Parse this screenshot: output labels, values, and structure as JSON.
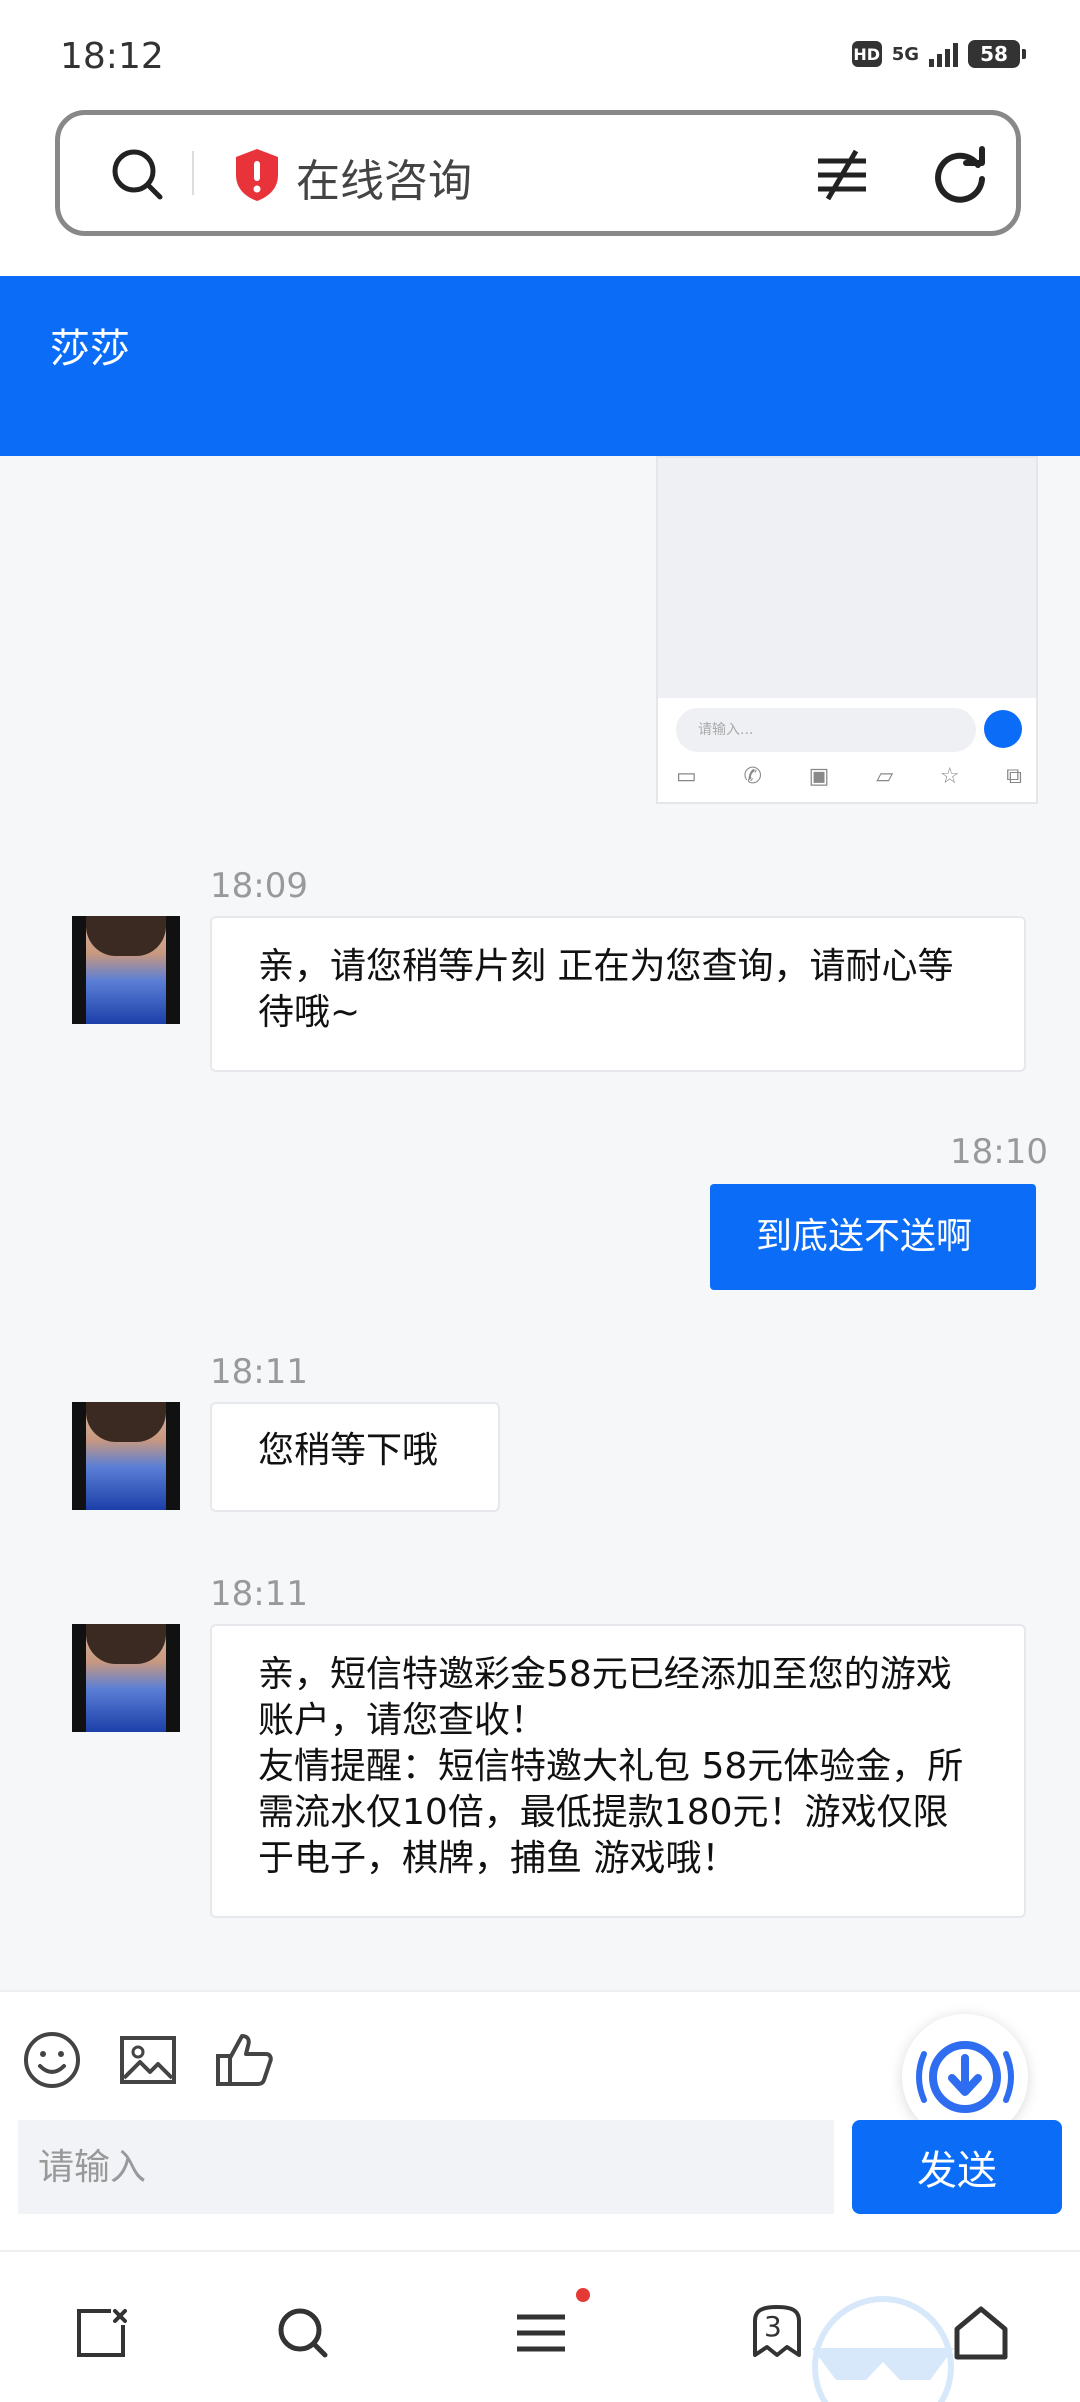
{
  "status_bar": {
    "time": "18:12",
    "hd": "HD",
    "network": "5G",
    "battery": "58"
  },
  "address_bar": {
    "title": "在线咨询"
  },
  "chat": {
    "agent_name": "莎莎"
  },
  "thumbnail": {
    "input_placeholder": "请输入..."
  },
  "messages": [
    {
      "side": "in",
      "time": "18:09",
      "text": "亲，请您稍等片刻 正在为您查询，请耐心等待哦~"
    },
    {
      "side": "out",
      "time": "18:10",
      "text": "到底送不送啊"
    },
    {
      "side": "in",
      "time": "18:11",
      "text": "您稍等下哦"
    },
    {
      "side": "in",
      "time": "18:11",
      "text": "亲，短信特邀彩金58元已经添加至您的游戏账户，请您查收！\n友情提醒：短信特邀大礼包 58元体验金，所需流水仅10倍，最低提款180元！游戏仅限于电子，棋牌，捕鱼 游戏哦！"
    }
  ],
  "input": {
    "placeholder": "请输入",
    "send_label": "发送"
  },
  "nav": {
    "tabs_count": "3"
  },
  "colors": {
    "accent": "#0a6cf7",
    "header_bg": "#0a6cf7",
    "chat_bg": "#f6f7f9",
    "badge": "#e53935"
  }
}
